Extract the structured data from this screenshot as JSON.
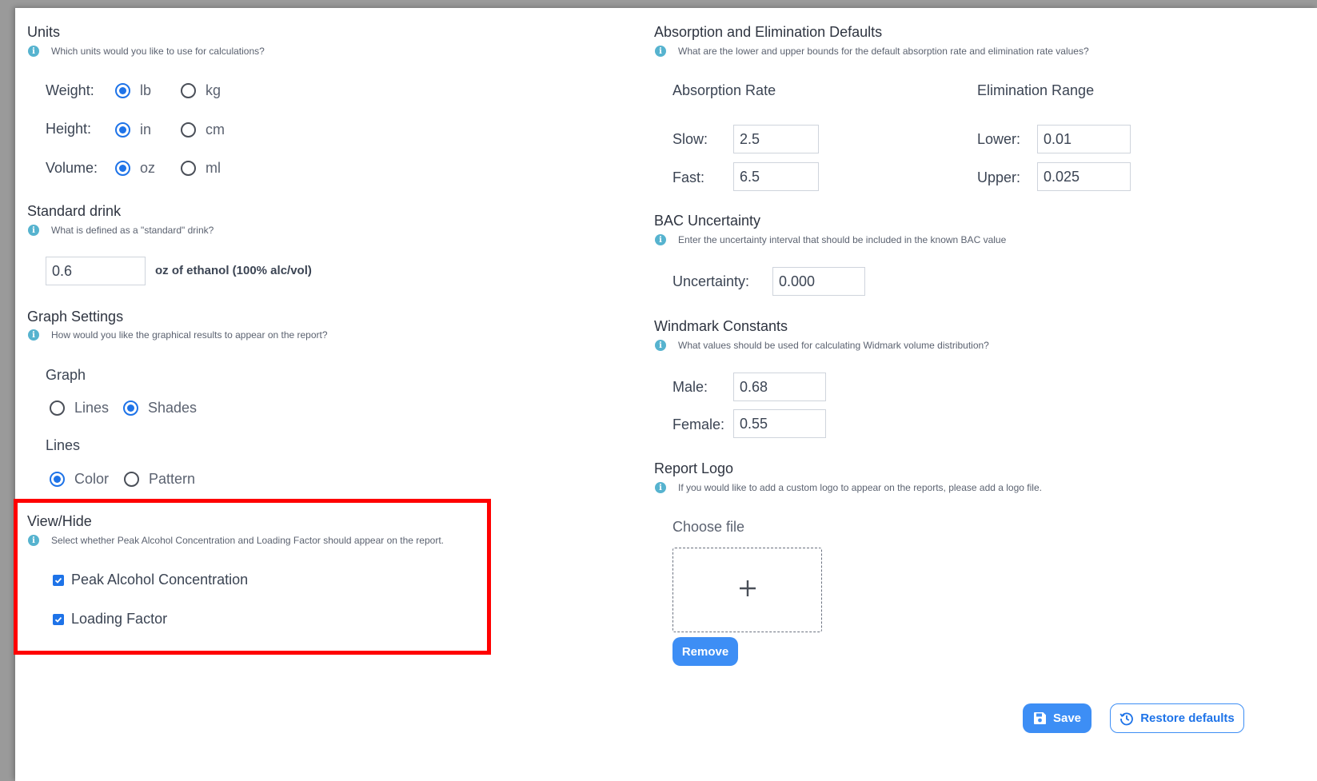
{
  "units": {
    "title": "Units",
    "hint": "Which units would you like to use for calculations?",
    "weight": {
      "label": "Weight:",
      "opt1": "lb",
      "opt2": "kg"
    },
    "height": {
      "label": "Height:",
      "opt1": "in",
      "opt2": "cm"
    },
    "volume": {
      "label": "Volume:",
      "opt1": "oz",
      "opt2": "ml"
    }
  },
  "standard_drink": {
    "title": "Standard drink",
    "hint": "What is defined as a \"standard\" drink?",
    "value": "0.6",
    "suffix": "oz of ethanol (100% alc/vol)"
  },
  "graph_settings": {
    "title": "Graph Settings",
    "hint": "How would you like the graphical results to appear on the report?",
    "graph_label": "Graph",
    "graph_opt1": "Lines",
    "graph_opt2": "Shades",
    "lines_label": "Lines",
    "lines_opt1": "Color",
    "lines_opt2": "Pattern"
  },
  "view_hide": {
    "title": "View/Hide",
    "hint": "Select whether Peak Alcohol Concentration and Loading Factor should appear on the report.",
    "item1": "Peak Alcohol Concentration",
    "item2": "Loading Factor"
  },
  "absorption": {
    "title": "Absorption and Elimination Defaults",
    "hint": "What are the lower and upper bounds for the default absorption rate and elimination rate values?",
    "absorption_label": "Absorption Rate",
    "elimination_label": "Elimination Range",
    "slow_label": "Slow:",
    "slow_value": "2.5",
    "fast_label": "Fast:",
    "fast_value": "6.5",
    "lower_label": "Lower:",
    "lower_value": "0.01",
    "upper_label": "Upper:",
    "upper_value": "0.025"
  },
  "bac": {
    "title": "BAC Uncertainty",
    "hint": "Enter the uncertainty interval that should be included in the known BAC value",
    "label": "Uncertainty:",
    "value": "0.000"
  },
  "windmark": {
    "title": "Windmark Constants",
    "hint": "What values should be used for calculating Widmark volume distribution?",
    "male_label": "Male:",
    "male_value": "0.68",
    "female_label": "Female:",
    "female_value": "0.55"
  },
  "logo": {
    "title": "Report Logo",
    "hint": "If you would like to add a custom logo to appear on the reports, please add a logo file.",
    "choose_label": "Choose file",
    "remove_label": "Remove"
  },
  "actions": {
    "save_label": "Save",
    "restore_label": "Restore defaults"
  },
  "colors": {
    "accent": "#1e73e8",
    "button": "#3d8ef5",
    "info": "#56b3cf",
    "highlight": "#ff0000"
  }
}
